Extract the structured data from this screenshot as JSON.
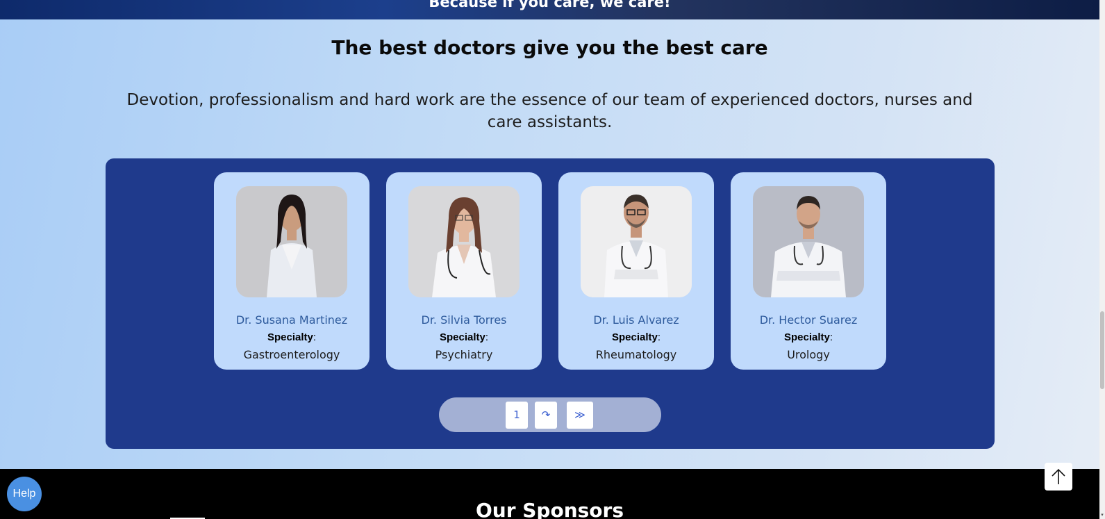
{
  "hero": {
    "tagline": "Because if you care, we care!"
  },
  "section": {
    "title": "The best doctors give you the best care",
    "description": "Devotion, professionalism and hard work are the essence of our team of experienced doctors, nurses and care assistants."
  },
  "doctors": [
    {
      "name": "Dr. Susana Martinez",
      "specialty_label": "Specialty",
      "specialty": "Gastroenterology"
    },
    {
      "name": "Dr. Silvia Torres",
      "specialty_label": "Specialty",
      "specialty": "Psychiatry"
    },
    {
      "name": "Dr. Luis Alvarez",
      "specialty_label": "Specialty",
      "specialty": "Rheumatology"
    },
    {
      "name": "Dr. Hector Suarez",
      "specialty_label": "Specialty",
      "specialty": "Urology"
    }
  ],
  "pagination": {
    "current_page": "1",
    "next_icon": "↷",
    "last_icon": "≫"
  },
  "footer": {
    "title": "Our Sponsors"
  },
  "help": {
    "label": "Help"
  },
  "icons": {
    "back_to_top": "arrow-up-icon",
    "scroll_down": "scroll-down-arrow-icon"
  },
  "colors": {
    "panel": "#1f3a8c",
    "card": "#c0dafc",
    "doctor_name": "#2d5a9c",
    "help_button": "#4a90e2"
  }
}
